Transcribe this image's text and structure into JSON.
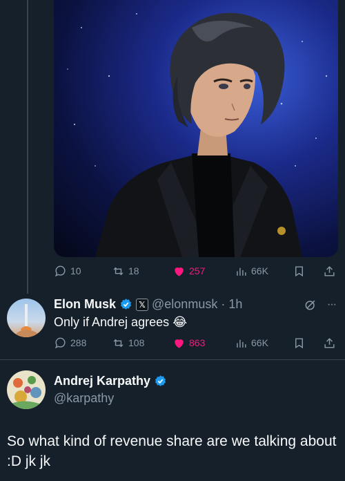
{
  "colors": {
    "background": "#15202b",
    "text": "#f7f9f9",
    "muted": "#8b98a5",
    "like": "#f91880",
    "verified": "#1d9bf0"
  },
  "top_tweet": {
    "actions": {
      "replies": "10",
      "reposts": "18",
      "likes": "257",
      "views": "66K"
    }
  },
  "reply": {
    "name": "Elon Musk",
    "handle": "@elonmusk",
    "separator": "·",
    "time": "1h",
    "text": "Only if Andrej agrees",
    "emoji": "😂",
    "actions": {
      "replies": "288",
      "reposts": "108",
      "likes": "863",
      "views": "66K"
    },
    "more": "···"
  },
  "main_tweet": {
    "name": "Andrej Karpathy",
    "handle": "@karpathy",
    "text": "So what kind of revenue share are we talking about :D jk jk"
  }
}
